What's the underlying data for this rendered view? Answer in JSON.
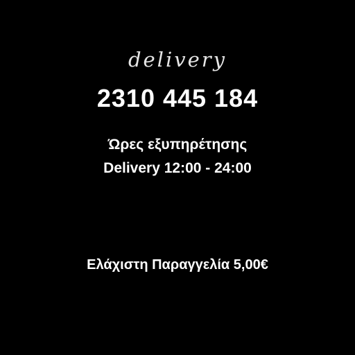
{
  "colors": {
    "background": "#000000",
    "text": "#ffffff"
  },
  "delivery": {
    "title": "delivery",
    "phone": "2310 445 184",
    "hours_label": "Ώρες εξυπηρέτησης",
    "hours_value": "Delivery 12:00 - 24:00",
    "minimum_order": "Ελάχιστη Παραγγελία 5,00€"
  }
}
